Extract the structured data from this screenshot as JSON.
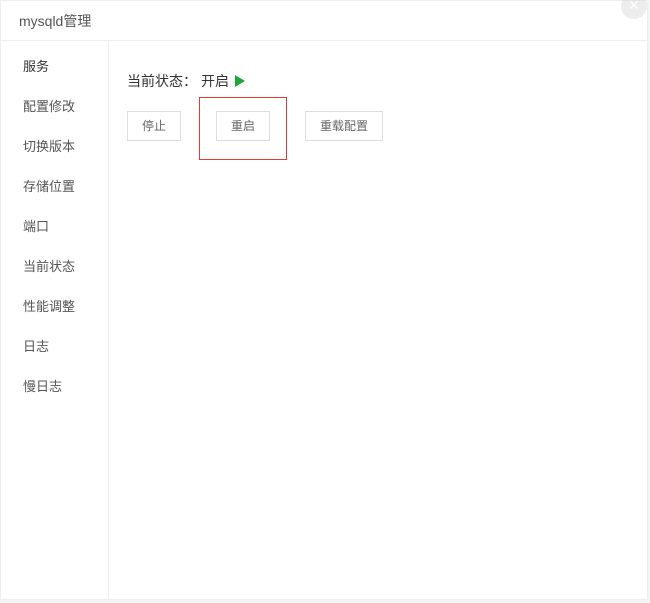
{
  "dialog": {
    "title": "mysqld管理"
  },
  "sidebar": {
    "items": [
      {
        "label": "服务",
        "active": true
      },
      {
        "label": "配置修改"
      },
      {
        "label": "切换版本"
      },
      {
        "label": "存储位置"
      },
      {
        "label": "端口"
      },
      {
        "label": "当前状态"
      },
      {
        "label": "性能调整"
      },
      {
        "label": "日志"
      },
      {
        "label": "慢日志"
      }
    ]
  },
  "main": {
    "status_label": "当前状态：",
    "status_value": "开启",
    "buttons": {
      "stop": "停止",
      "restart": "重启",
      "reload_config": "重载配置"
    }
  }
}
